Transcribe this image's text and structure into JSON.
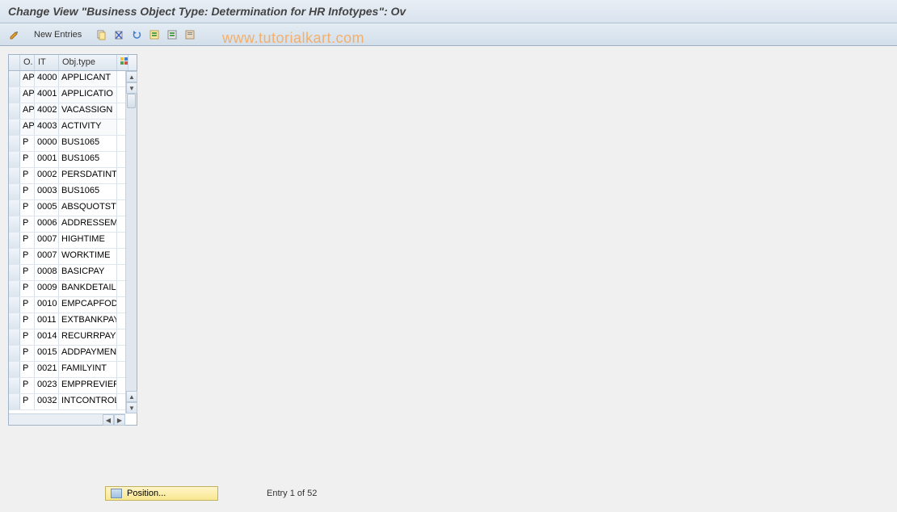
{
  "title": "Change View \"Business Object Type: Determination for HR Infotypes\": Ov",
  "toolbar": {
    "new_entries": "New Entries"
  },
  "watermark": "www.tutorialkart.com",
  "table": {
    "headers": {
      "sel": "",
      "o": "O.",
      "it": "IT",
      "obj": "Obj.type"
    },
    "rows": [
      {
        "o": "AP",
        "it": "4000",
        "obj": "APPLICANT"
      },
      {
        "o": "AP",
        "it": "4001",
        "obj": "APPLICATIO"
      },
      {
        "o": "AP",
        "it": "4002",
        "obj": "VACASSIGN"
      },
      {
        "o": "AP",
        "it": "4003",
        "obj": "ACTIVITY"
      },
      {
        "o": "P",
        "it": "0000",
        "obj": "BUS1065"
      },
      {
        "o": "P",
        "it": "0001",
        "obj": "BUS1065"
      },
      {
        "o": "P",
        "it": "0002",
        "obj": "PERSDATINT"
      },
      {
        "o": "P",
        "it": "0003",
        "obj": "BUS1065"
      },
      {
        "o": "P",
        "it": "0005",
        "obj": "ABSQUOTSTL"
      },
      {
        "o": "P",
        "it": "0006",
        "obj": "ADDRESSEMP"
      },
      {
        "o": "P",
        "it": "0007",
        "obj": "HIGHTIME"
      },
      {
        "o": "P",
        "it": "0007",
        "obj": "WORKTIME"
      },
      {
        "o": "P",
        "it": "0008",
        "obj": "BASICPAY"
      },
      {
        "o": "P",
        "it": "0009",
        "obj": "BANKDETAIL"
      },
      {
        "o": "P",
        "it": "0010",
        "obj": "EMPCAPFODE"
      },
      {
        "o": "P",
        "it": "0011",
        "obj": "EXTBANKPAY"
      },
      {
        "o": "P",
        "it": "0014",
        "obj": "RECURRPAY"
      },
      {
        "o": "P",
        "it": "0015",
        "obj": "ADDPAYMENT"
      },
      {
        "o": "P",
        "it": "0021",
        "obj": "FAMILYINT"
      },
      {
        "o": "P",
        "it": "0023",
        "obj": "EMPPREVIER"
      },
      {
        "o": "P",
        "it": "0032",
        "obj": "INTCONTROL"
      }
    ]
  },
  "position": {
    "button_label": "Position...",
    "entry_info": "Entry 1 of 52"
  }
}
